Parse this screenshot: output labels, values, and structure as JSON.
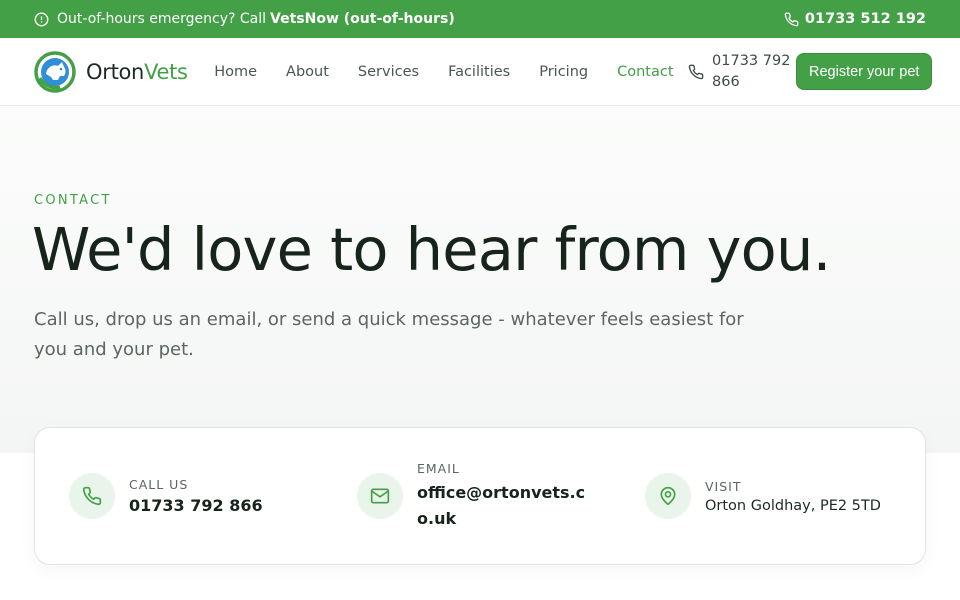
{
  "topbar": {
    "emergency_text": "Out-of-hours emergency? Call ",
    "emergency_link": "VetsNow (out-of-hours)",
    "phone": "01733 512 192",
    "bg_color": "#43a047"
  },
  "brand": {
    "name_part1": "Orton",
    "name_part2": "Vets",
    "accent_color": "#43a047"
  },
  "nav": {
    "items": [
      {
        "label": "Home"
      },
      {
        "label": "About"
      },
      {
        "label": "Services"
      },
      {
        "label": "Facilities"
      },
      {
        "label": "Pricing"
      },
      {
        "label": "Contact",
        "active": true
      }
    ],
    "phone": "01733 792 866",
    "cta": "Register your pet"
  },
  "hero": {
    "eyebrow": "CONTACT",
    "title": "We'd love to hear from you.",
    "subtitle": "Call us, drop us an email, or send a quick message - whatever feels easiest for you and your pet."
  },
  "contact_cards": {
    "call": {
      "label": "CALL US",
      "value": "01733 792 866",
      "icon": "phone-icon"
    },
    "email": {
      "label": "EMAIL",
      "value": "office@ortonvets.co.uk",
      "icon": "mail-icon"
    },
    "visit": {
      "label": "VISIT",
      "value": "Orton Goldhay, PE2 5TD",
      "icon": "map-pin-icon"
    }
  }
}
